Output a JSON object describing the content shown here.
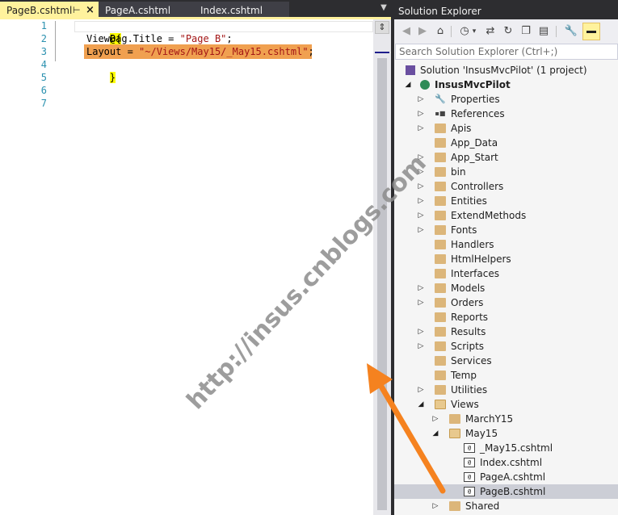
{
  "editor": {
    "tabs": [
      {
        "label": "PageB.cshtml",
        "active": true,
        "pin": "⊢",
        "close": "×"
      },
      {
        "label": "PageA.cshtml",
        "active": false
      },
      {
        "label": "Index.cshtml",
        "active": false
      }
    ],
    "line_numbers": [
      "1",
      "2",
      "3",
      "4",
      "5",
      "6",
      "7"
    ],
    "code": {
      "l1": "@{",
      "l2_a": "ViewBag.Title = ",
      "l2_b": "\"Page B\"",
      "l2_c": ";",
      "l3_a": "Layout = ",
      "l3_b": "\"~/Views/May15/_May15.cshtml\"",
      "l3_c": ";",
      "l4": "}"
    },
    "highlight_color": "#f0a050"
  },
  "solution_explorer": {
    "title": "Solution Explorer",
    "search_placeholder": "Search Solution Explorer (Ctrl+;)",
    "solution": "Solution 'InsusMvcPilot' (1 project)",
    "project": "InsusMvcPilot",
    "items": [
      {
        "label": "Properties",
        "icon": "wrench-icon",
        "expandable": true
      },
      {
        "label": "References",
        "icon": "references-icon",
        "expandable": true
      },
      {
        "label": "Apis",
        "icon": "folder-icon",
        "expandable": true
      },
      {
        "label": "App_Data",
        "icon": "folder-icon",
        "expandable": false
      },
      {
        "label": "App_Start",
        "icon": "folder-icon",
        "expandable": true
      },
      {
        "label": "bin",
        "icon": "folder-icon",
        "expandable": true
      },
      {
        "label": "Controllers",
        "icon": "folder-icon",
        "expandable": true
      },
      {
        "label": "Entities",
        "icon": "folder-icon",
        "expandable": true
      },
      {
        "label": "ExtendMethods",
        "icon": "folder-icon",
        "expandable": true
      },
      {
        "label": "Fonts",
        "icon": "folder-icon",
        "expandable": true
      },
      {
        "label": "Handlers",
        "icon": "folder-icon",
        "expandable": false
      },
      {
        "label": "HtmlHelpers",
        "icon": "folder-icon",
        "expandable": false
      },
      {
        "label": "Interfaces",
        "icon": "folder-icon",
        "expandable": false
      },
      {
        "label": "Models",
        "icon": "folder-icon",
        "expandable": true
      },
      {
        "label": "Orders",
        "icon": "folder-icon",
        "expandable": true
      },
      {
        "label": "Reports",
        "icon": "folder-icon",
        "expandable": false
      },
      {
        "label": "Results",
        "icon": "folder-icon",
        "expandable": true
      },
      {
        "label": "Scripts",
        "icon": "folder-icon",
        "expandable": true
      },
      {
        "label": "Services",
        "icon": "folder-icon",
        "expandable": false
      },
      {
        "label": "Temp",
        "icon": "folder-icon",
        "expandable": false
      },
      {
        "label": "Utilities",
        "icon": "folder-icon",
        "expandable": true
      },
      {
        "label": "Views",
        "icon": "folder-open-icon",
        "expandable": true,
        "expanded": true
      }
    ],
    "views_children": [
      {
        "label": "MarchY15",
        "icon": "folder-icon",
        "expandable": true
      },
      {
        "label": "May15",
        "icon": "folder-open-icon",
        "expandable": true,
        "expanded": true
      }
    ],
    "may15_children": [
      {
        "label": "_May15.cshtml",
        "icon": "razor-file-icon"
      },
      {
        "label": "Index.cshtml",
        "icon": "razor-file-icon"
      },
      {
        "label": "PageA.cshtml",
        "icon": "razor-file-icon"
      },
      {
        "label": "PageB.cshtml",
        "icon": "razor-file-icon",
        "selected": true
      }
    ],
    "after": [
      {
        "label": "Shared",
        "icon": "folder-icon",
        "expandable": true
      }
    ]
  },
  "watermark": "http://insus.cnblogs.com",
  "accent_colors": {
    "arrow": "#f5821f",
    "active_tab": "#fff29d",
    "selection": "#ccced6"
  }
}
